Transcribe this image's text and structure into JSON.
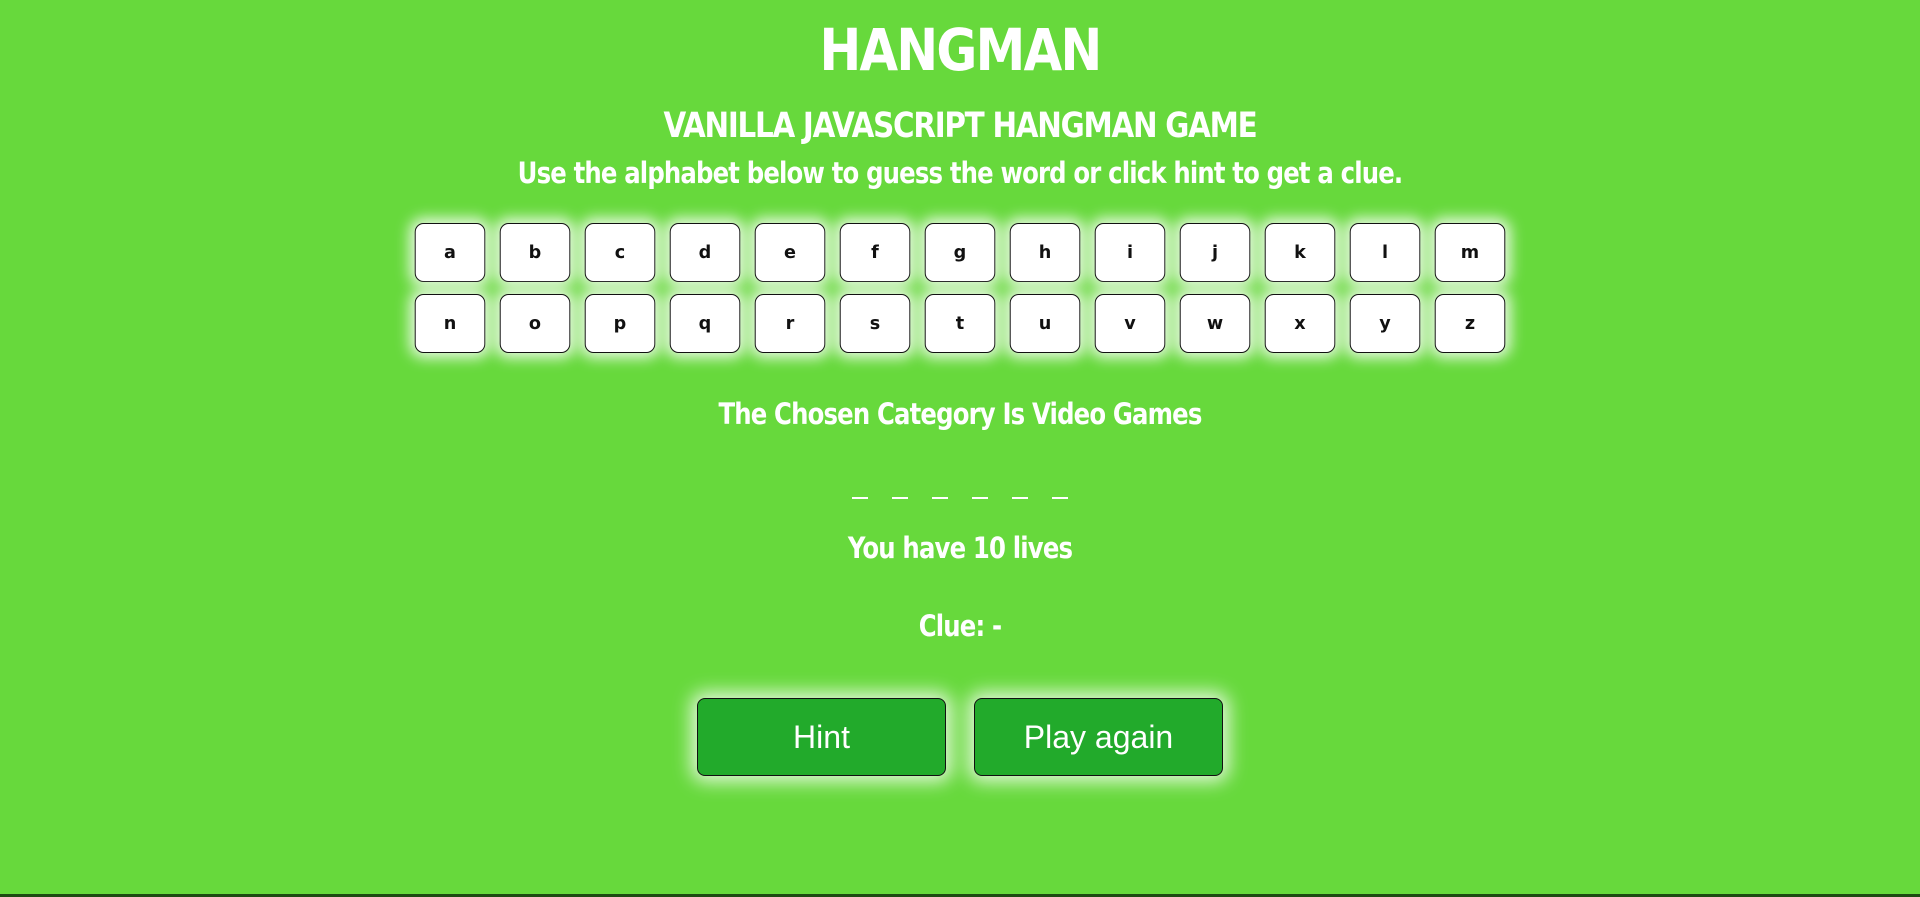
{
  "header": {
    "title": "HANGMAN",
    "subtitle": "VANILLA JAVASCRIPT HANGMAN GAME",
    "instructions": "Use the alphabet below to guess the word or click hint to get a clue."
  },
  "alphabet": {
    "row1": [
      "a",
      "b",
      "c",
      "d",
      "e",
      "f",
      "g",
      "h",
      "i",
      "j",
      "k",
      "l",
      "m"
    ],
    "row2": [
      "n",
      "o",
      "p",
      "q",
      "r",
      "s",
      "t",
      "u",
      "v",
      "w",
      "x",
      "y",
      "z"
    ]
  },
  "game": {
    "category": "The Chosen Category Is Video Games",
    "word_length": 6,
    "lives": "You have 10 lives",
    "clue": "Clue: -"
  },
  "controls": {
    "hint_label": "Hint",
    "reset_label": "Play again"
  },
  "colors": {
    "background": "#67d93c",
    "button": "#22aa2b",
    "text": "#ffffff"
  }
}
